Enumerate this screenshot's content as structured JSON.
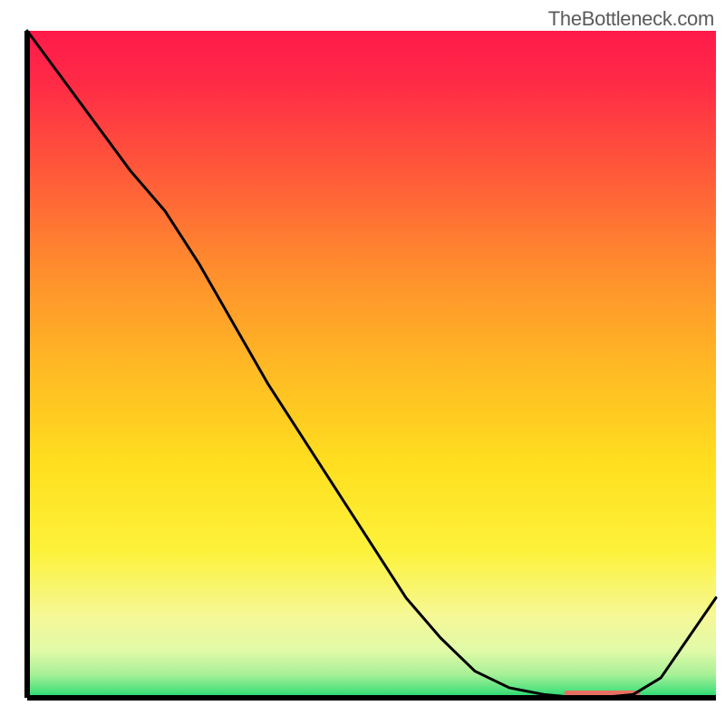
{
  "watermark": "TheBottleneck.com",
  "chart_data": {
    "type": "line",
    "x": [
      0.0,
      0.05,
      0.1,
      0.15,
      0.2,
      0.25,
      0.3,
      0.35,
      0.4,
      0.45,
      0.5,
      0.55,
      0.6,
      0.65,
      0.7,
      0.75,
      0.8,
      0.83,
      0.88,
      0.92,
      1.0
    ],
    "values": [
      1.0,
      0.93,
      0.86,
      0.79,
      0.73,
      0.65,
      0.56,
      0.47,
      0.39,
      0.31,
      0.23,
      0.15,
      0.09,
      0.04,
      0.015,
      0.005,
      0.0,
      0.0,
      0.005,
      0.03,
      0.15
    ],
    "stripe_x_start": 0.78,
    "stripe_x_end": 0.89,
    "title": "",
    "xlabel": "",
    "ylabel": "",
    "xlim": [
      0,
      1
    ],
    "ylim": [
      0,
      1
    ],
    "gradient_stops": [
      {
        "offset": 0.0,
        "color": "#ff1a4a"
      },
      {
        "offset": 0.08,
        "color": "#ff2b46"
      },
      {
        "offset": 0.2,
        "color": "#ff553b"
      },
      {
        "offset": 0.35,
        "color": "#ff8b2e"
      },
      {
        "offset": 0.5,
        "color": "#ffb824"
      },
      {
        "offset": 0.65,
        "color": "#ffdf1f"
      },
      {
        "offset": 0.78,
        "color": "#fdf23a"
      },
      {
        "offset": 0.88,
        "color": "#f5f898"
      },
      {
        "offset": 0.93,
        "color": "#e0faa8"
      },
      {
        "offset": 0.965,
        "color": "#a7f097"
      },
      {
        "offset": 0.99,
        "color": "#4de17e"
      },
      {
        "offset": 1.0,
        "color": "#18d66a"
      }
    ],
    "stripe_color": "#e77062",
    "stroke_color": "#000000",
    "axis_color": "#000000"
  }
}
